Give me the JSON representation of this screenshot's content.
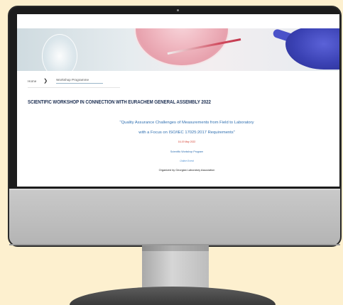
{
  "breadcrumb": {
    "home": "Home",
    "separator": "❯",
    "current": "Workshop Programme"
  },
  "page": {
    "title": "SCIENTIFIC WORKSHOP IN CONNECTION WITH EURACHEM GENERAL ASSEMBLY 2022",
    "subtitle_line1": "\"Quality Assurance Challenges of Measurements from Field to Laboratory",
    "subtitle_line2": "with a Focus on ISO/IEC 17025:2017 Requirements\"",
    "dates": "16-19 May 2022",
    "program_link": "Scientific Workshop Program",
    "event_type": "Online Event",
    "organizer": "Organized by Georgian Laboratory Association"
  },
  "colors": {
    "title": "#1f3154",
    "accent_blue": "#2f6fb0",
    "date_red": "#d33b2c",
    "background": "#fdf0cf"
  }
}
